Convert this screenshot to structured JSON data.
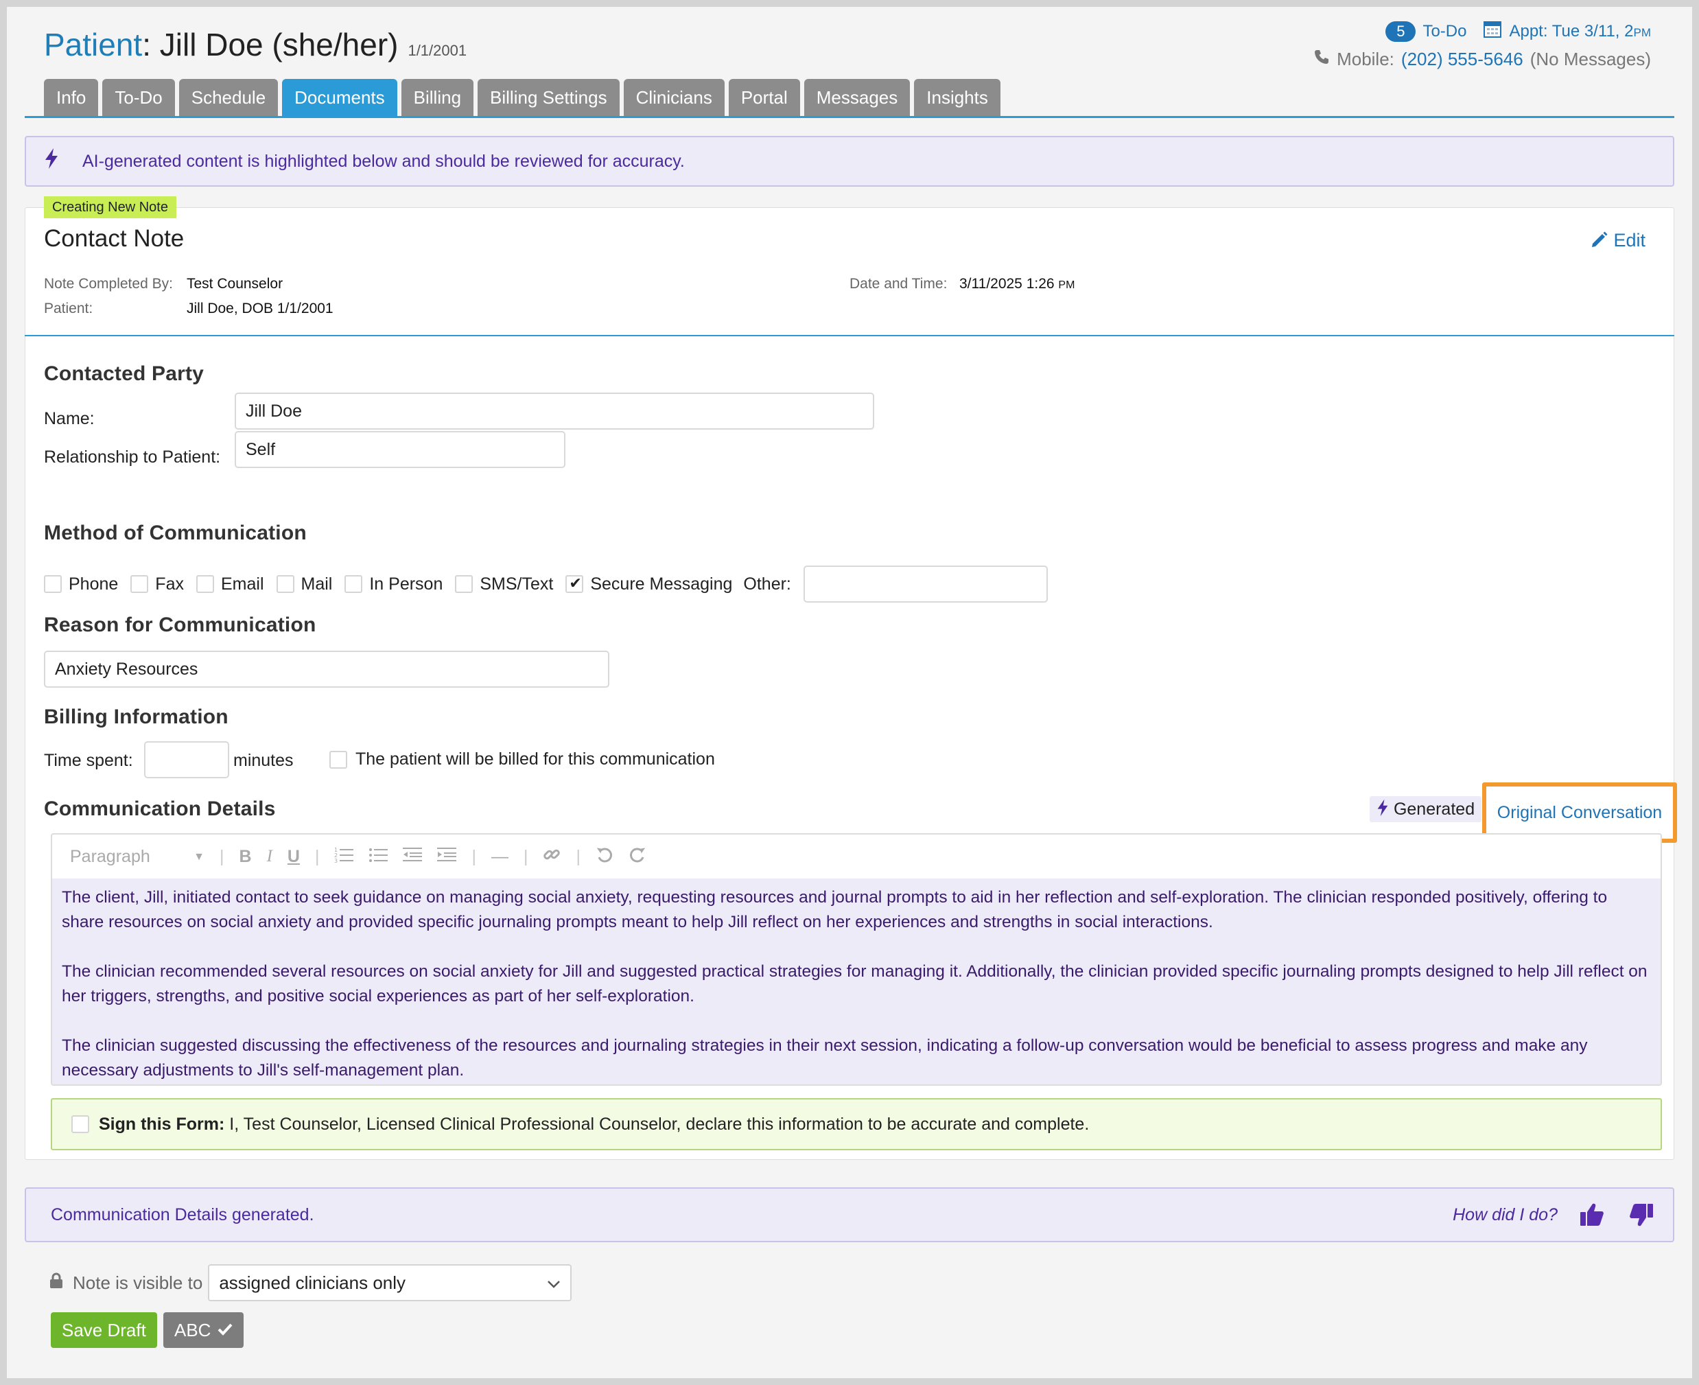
{
  "header": {
    "patient_label": "Patient",
    "patient_name": ": Jill Doe (she/her)",
    "patient_dob": "1/1/2001",
    "todo_count": "5",
    "todo_label": "To-Do",
    "appt": "Appt: Tue 3/11, 2",
    "appt_suffix": "PM",
    "mobile_label": "Mobile:",
    "mobile_number": "(202) 555-5646",
    "mobile_note": "(No Messages)"
  },
  "tabs": [
    "Info",
    "To-Do",
    "Schedule",
    "Documents",
    "Billing",
    "Billing Settings",
    "Clinicians",
    "Portal",
    "Messages",
    "Insights"
  ],
  "active_tab": "Documents",
  "ai_banner": "AI-generated content is highlighted below and should be reviewed for accuracy.",
  "note": {
    "badge": "Creating New Note",
    "title": "Contact Note",
    "edit": "Edit",
    "completed_by_label": "Note Completed By:",
    "completed_by": "Test Counselor",
    "patient_label": "Patient:",
    "patient": "Jill Doe, DOB 1/1/2001",
    "datetime_label": "Date and Time:",
    "datetime": "3/11/2025 1:26",
    "datetime_suffix": "PM"
  },
  "contacted_party": {
    "heading": "Contacted Party",
    "name_label": "Name:",
    "name_value": "Jill Doe",
    "relationship_label": "Relationship to Patient:",
    "relationship_value": "Self"
  },
  "method": {
    "heading": "Method of Communication",
    "options": [
      "Phone",
      "Fax",
      "Email",
      "Mail",
      "In Person",
      "SMS/Text",
      "Secure Messaging"
    ],
    "checked": "Secure Messaging",
    "other_label": "Other:",
    "other_value": ""
  },
  "reason": {
    "heading": "Reason for Communication",
    "value": "Anxiety Resources"
  },
  "billing": {
    "heading": "Billing Information",
    "time_label": "Time spent:",
    "time_value": "",
    "minutes": "minutes",
    "billed_label": "The patient will be billed for this communication"
  },
  "details": {
    "heading": "Communication Details",
    "generated": "Generated",
    "original_conversation": "Original Conversation",
    "toolbar_format": "Paragraph",
    "paragraphs": [
      "The client, Jill, initiated contact to seek guidance on managing social anxiety, requesting resources and journal prompts to aid in her reflection and self-exploration. The clinician responded positively, offering to share resources on social anxiety and provided specific journaling prompts meant to help Jill reflect on her experiences and strengths in social interactions.",
      "The clinician recommended several resources on social anxiety for Jill and suggested practical strategies for managing it. Additionally, the clinician provided specific journaling prompts designed to help Jill reflect on her triggers, strengths, and positive social experiences as part of her self-exploration.",
      "The clinician suggested discussing the effectiveness of the resources and journaling strategies in their next session, indicating a follow-up conversation would be beneficial to assess progress and make any necessary adjustments to Jill's self-management plan."
    ]
  },
  "sign": {
    "label": "Sign this Form:",
    "text": " I, Test Counselor, Licensed Clinical Professional Counselor, declare this information to be accurate and complete."
  },
  "feedback": {
    "message": "Communication Details generated.",
    "question": "How did I do?"
  },
  "visibility": {
    "label": "Note is visible to",
    "value": "assigned clinicians only"
  },
  "buttons": {
    "save_draft": "Save Draft",
    "abc": "ABC"
  },
  "colors": {
    "accent": "#2b9bd8",
    "link": "#1e74b6",
    "ai_purple": "#4a2a9e",
    "ai_bg": "#ecebf7",
    "highlight_orange": "#f29a2e",
    "save_green": "#6db52b"
  }
}
